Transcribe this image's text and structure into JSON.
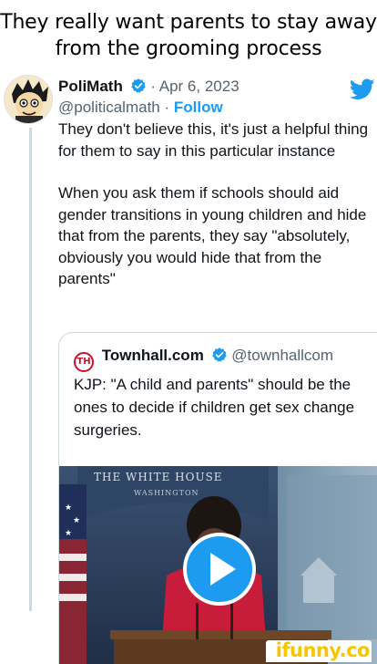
{
  "caption": "They really want parents to stay away from the grooming process",
  "tweet": {
    "author_name": "PoliMath",
    "date": " · Apr 6, 2023",
    "handle": "@politicalmath",
    "separator": " · ",
    "follow_label": "Follow",
    "paragraphs": [
      "They don't believe this, it's just a helpful thing for them to say in this particular instance",
      "When you ask them if schools should aid gender transitions in young children and hide that from the parents, they say \"absolutely, obviously you would hide that from the parents\""
    ]
  },
  "quote": {
    "logo_text": "TH",
    "author_name": "Townhall.com",
    "handle": "@townhallcom",
    "text": "KJP: \"A child and parents\" should be the ones to decide if children get sex change surgeries.",
    "video": {
      "backdrop_line1": "THE WHITE HOUSE",
      "backdrop_line2": "WASHINGTON"
    }
  },
  "watermark": "ifunny.co",
  "colors": {
    "twitter_blue": "#1d9bf0",
    "text": "#0f1419",
    "muted": "#536471",
    "border": "#cfd9de",
    "townhall_red": "#c8102e",
    "ifunny_yellow": "#f7c600"
  },
  "icons": [
    "verified-badge-icon",
    "twitter-bird-icon",
    "play-icon",
    "townhall-logo-icon"
  ]
}
